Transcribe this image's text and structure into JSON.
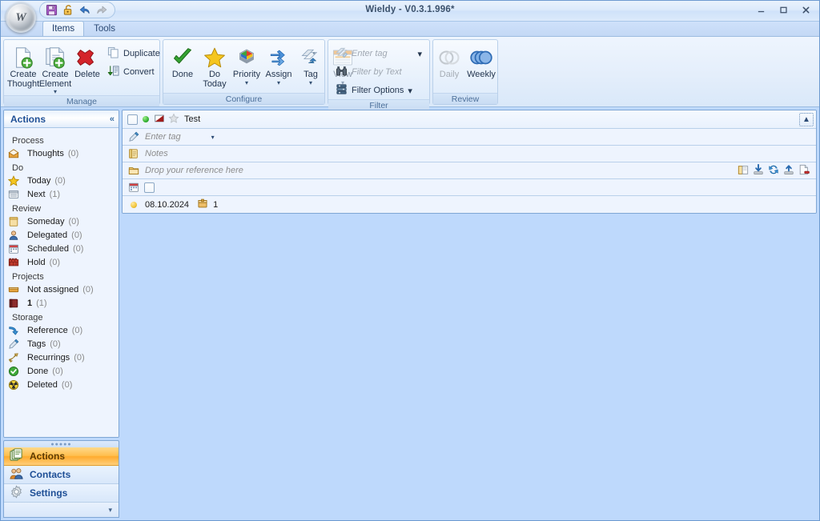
{
  "window": {
    "title": "Wieldy - V0.3.1.996*",
    "orb_label": "W",
    "controls": {
      "minimize": "Minimize",
      "maximize": "Maximize",
      "close": "Close"
    }
  },
  "quick_access": {
    "items": [
      {
        "name": "save-icon",
        "tooltip": "Save"
      },
      {
        "name": "unlock-icon",
        "tooltip": "Unlock"
      },
      {
        "name": "undo-icon",
        "tooltip": "Undo"
      },
      {
        "name": "redo-icon",
        "tooltip": "Redo"
      }
    ]
  },
  "tabs": [
    {
      "label": "Items",
      "active": true
    },
    {
      "label": "Tools",
      "active": false
    }
  ],
  "ribbon": {
    "groups": [
      {
        "title": "Manage",
        "large_buttons": [
          {
            "label": "Create\nThought",
            "icon": "new-document-icon",
            "caret": false
          },
          {
            "label": "Create\nElement",
            "icon": "new-element-icon",
            "caret": true
          },
          {
            "label": "Delete",
            "icon": "delete-x-icon",
            "caret": false
          }
        ],
        "small_buttons": [
          {
            "label": "Duplicate",
            "icon": "duplicate-icon"
          },
          {
            "label": "Convert",
            "icon": "convert-icon"
          }
        ]
      },
      {
        "title": "Configure",
        "large_buttons": [
          {
            "label": "Done",
            "icon": "check-icon",
            "caret": false
          },
          {
            "label": "Do\nToday",
            "icon": "star-icon",
            "caret": false
          },
          {
            "label": "Priority",
            "icon": "priority-icon",
            "caret": true
          },
          {
            "label": "Assign",
            "icon": "assign-arrows-icon",
            "caret": true
          },
          {
            "label": "Tag",
            "icon": "tag-icon",
            "caret": true
          },
          {
            "label": "View",
            "icon": "view-window-icon",
            "caret": true
          }
        ],
        "small_buttons": []
      },
      {
        "title": "Filter",
        "large_buttons": [],
        "small_buttons": [
          {
            "label": "Enter tag",
            "icon": "tag-filter-icon",
            "disabled": true,
            "caret": true
          },
          {
            "label": "Filter by Text",
            "icon": "binoculars-icon",
            "disabled": true,
            "caret": false
          },
          {
            "label": "Filter Options",
            "icon": "filter-options-icon",
            "disabled": false,
            "caret": true
          }
        ]
      },
      {
        "title": "Review",
        "large_buttons": [
          {
            "label": "Daily",
            "icon": "daily-rings-icon",
            "disabled": true,
            "caret": false
          },
          {
            "label": "Weekly",
            "icon": "weekly-rings-icon",
            "disabled": false,
            "caret": false
          }
        ],
        "small_buttons": []
      }
    ]
  },
  "sidebar": {
    "header": "Actions",
    "collapse_glyph": "«",
    "groups": [
      {
        "section": "Process",
        "items": [
          {
            "label": "Thoughts",
            "count": "(0)",
            "icon": "inbox-icon"
          }
        ]
      },
      {
        "section": "Do",
        "items": [
          {
            "label": "Today",
            "count": "(0)",
            "icon": "star-icon"
          },
          {
            "label": "Next",
            "count": "(1)",
            "icon": "next-list-icon"
          }
        ]
      },
      {
        "section": "Review",
        "items": [
          {
            "label": "Someday",
            "count": "(0)",
            "icon": "someday-note-icon"
          },
          {
            "label": "Delegated",
            "count": "(0)",
            "icon": "person-icon"
          },
          {
            "label": "Scheduled",
            "count": "(0)",
            "icon": "calendar-icon"
          },
          {
            "label": "Hold",
            "count": "(0)",
            "icon": "hold-wall-icon"
          }
        ]
      },
      {
        "section": "Projects",
        "items": [
          {
            "label": "Not assigned",
            "count": "(0)",
            "icon": "folder-bar-icon"
          },
          {
            "label": "1",
            "count": "(1)",
            "icon": "project-book-icon",
            "bold": true
          }
        ]
      },
      {
        "section": "Storage",
        "items": [
          {
            "label": "Reference",
            "count": "(0)",
            "icon": "reference-arrow-icon"
          },
          {
            "label": "Tags",
            "count": "(0)",
            "icon": "pen-tag-icon"
          },
          {
            "label": "Recurrings",
            "count": "(0)",
            "icon": "recurring-icon"
          },
          {
            "label": "Done",
            "count": "(0)",
            "icon": "done-check-icon"
          },
          {
            "label": "Deleted",
            "count": "(0)",
            "icon": "deleted-icon"
          }
        ]
      }
    ],
    "nav": [
      {
        "label": "Actions",
        "icon": "actions-stack-icon",
        "active": true
      },
      {
        "label": "Contacts",
        "icon": "contacts-people-icon",
        "active": false
      },
      {
        "label": "Settings",
        "icon": "gear-icon",
        "active": false
      }
    ],
    "nav_more_glyph": "▾"
  },
  "main": {
    "item": {
      "title": "Test",
      "collapse_glyph": "«",
      "status_dot": "green",
      "priority_icon": "priority-flag-icon",
      "star_icon": "star-outline-icon",
      "tag_placeholder": "Enter tag",
      "notes_placeholder": "Notes",
      "reference_placeholder": "Drop your reference here",
      "reference_actions": [
        {
          "name": "open-folder-icon"
        },
        {
          "name": "download-icon"
        },
        {
          "name": "refresh-icon"
        },
        {
          "name": "upload-icon"
        },
        {
          "name": "remove-file-icon"
        }
      ],
      "date": "08.10.2024",
      "project": "1",
      "project_icon": "project-box-icon",
      "date_icon": "calendar-icon",
      "schedule_icon": "calendar-icon"
    }
  },
  "colors": {
    "accent_blue": "#1e4f96",
    "selection_orange": "#ffab2e",
    "canvas_blue": "#bed9fc",
    "panel_border": "#7fa6d4"
  }
}
